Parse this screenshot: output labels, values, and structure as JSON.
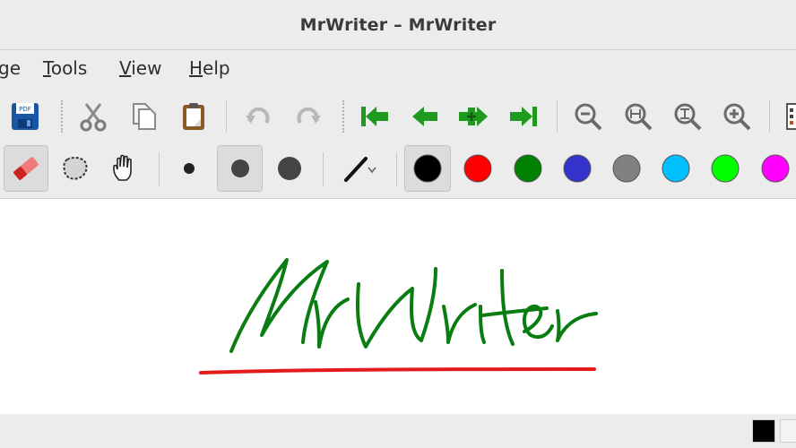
{
  "window": {
    "title": "MrWriter – MrWriter"
  },
  "menu": {
    "items": [
      {
        "id": "page",
        "mnemonic": "",
        "rest": "ge"
      },
      {
        "id": "tools",
        "mnemonic": "T",
        "rest": "ools"
      },
      {
        "id": "view",
        "mnemonic": "V",
        "rest": "iew"
      },
      {
        "id": "help",
        "mnemonic": "H",
        "rest": "elp"
      }
    ]
  },
  "toolbar1": {
    "save_pdf_icon_text": "PDF",
    "icons": [
      "save-pdf-icon",
      "cut-icon",
      "copy-icon",
      "paste-icon",
      "undo-icon",
      "redo-icon",
      "first-page-icon",
      "previous-page-icon",
      "new-page-icon",
      "last-page-icon",
      "zoom-out-icon",
      "zoom-fit-width-icon",
      "zoom-fit-height-icon",
      "zoom-in-icon",
      "page-settings-icon"
    ]
  },
  "toolbar2": {
    "tools": [
      "eraser-icon",
      "lasso-select-icon",
      "hand-pan-icon"
    ],
    "pen_sizes": [
      "small",
      "medium",
      "large"
    ],
    "selected_pen_size": "medium",
    "pen_style": "solid",
    "colors": [
      {
        "name": "black",
        "hex": "#000000"
      },
      {
        "name": "red",
        "hex": "#ff0000"
      },
      {
        "name": "green",
        "hex": "#008000"
      },
      {
        "name": "blue",
        "hex": "#3333cc"
      },
      {
        "name": "gray",
        "hex": "#808080"
      },
      {
        "name": "light-blue",
        "hex": "#00c0ff"
      },
      {
        "name": "lime",
        "hex": "#00ff00"
      },
      {
        "name": "magenta",
        "hex": "#ff00ff"
      }
    ],
    "selected_color": "black"
  },
  "canvas": {
    "handwriting": "MrWriter",
    "ink_color": "#0a7d12",
    "underline_color": "#e21b1b"
  },
  "statusbar": {
    "current_color": "#000000"
  },
  "theme": {
    "toolbar_bg": "#ececec",
    "green_nav": "#1e9a1e",
    "save_blue": "#1a56a8"
  }
}
